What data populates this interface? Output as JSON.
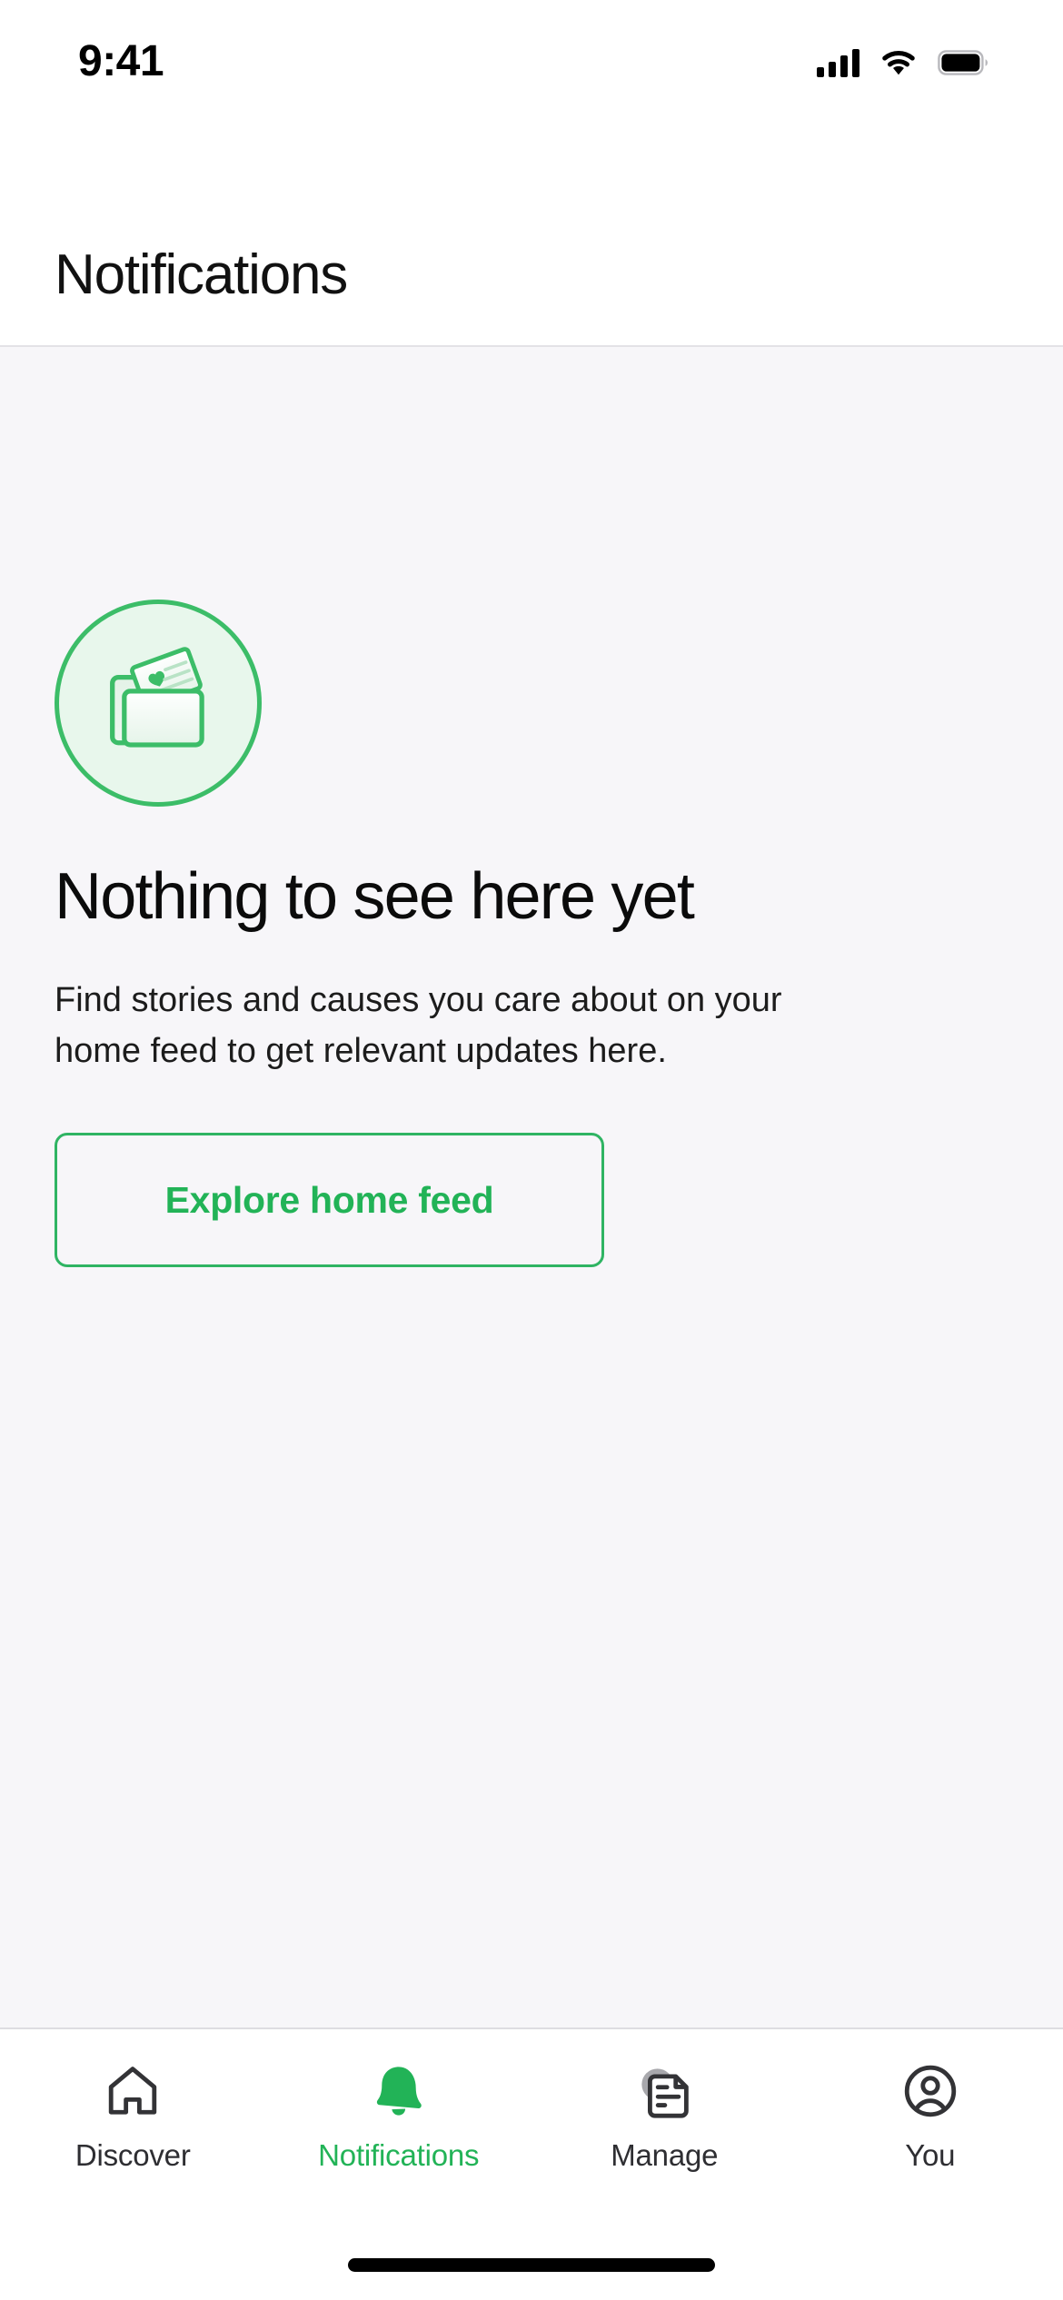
{
  "status_bar": {
    "time": "9:41",
    "signal_icon": "cellular-signal-icon",
    "wifi_icon": "wifi-icon",
    "battery_icon": "battery-full-icon"
  },
  "header": {
    "title": "Notifications"
  },
  "empty_state": {
    "illustration_icon": "folder-with-letter-illustration",
    "title": "Nothing to see here yet",
    "body": "Find stories and causes you care about on your home feed to get relevant updates here.",
    "cta_label": "Explore home feed"
  },
  "tab_bar": {
    "items": [
      {
        "label": "Discover",
        "icon": "home-icon",
        "active": false
      },
      {
        "label": "Notifications",
        "icon": "bell-icon",
        "active": true
      },
      {
        "label": "Manage",
        "icon": "document-icon",
        "active": false
      },
      {
        "label": "You",
        "icon": "person-circle-icon",
        "active": false
      }
    ]
  },
  "home_indicator": {
    "label": "home-indicator"
  },
  "colors": {
    "accent_green": "#22b357",
    "illustration_outline": "#3cbd68",
    "illustration_fill": "#e8f7ec",
    "content_background": "#f7f6f9",
    "surface": "#ffffff",
    "text_primary": "#0b0b0b",
    "text_secondary": "#2e2e32",
    "divider": "#dedde1"
  }
}
